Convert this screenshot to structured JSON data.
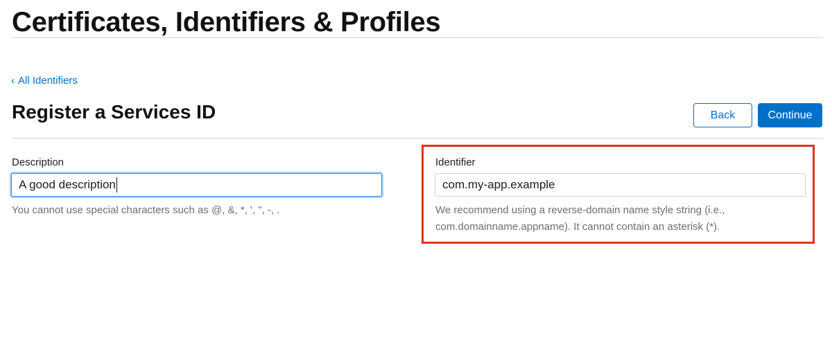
{
  "header": {
    "title": "Certificates, Identifiers & Profiles"
  },
  "nav": {
    "back_link_chevron": "‹",
    "back_link_label": "All Identifiers"
  },
  "section": {
    "title": "Register a Services ID"
  },
  "actions": {
    "back_label": "Back",
    "continue_label": "Continue"
  },
  "description_field": {
    "label": "Description",
    "value": "A good description",
    "help": "You cannot use special characters such as @, &, *, ', \", -, ."
  },
  "identifier_field": {
    "label": "Identifier",
    "value": "com.my-app.example",
    "help_line1": "We recommend using a reverse-domain name style string (i.e.,",
    "help_line2": "com.domainname.appname). It cannot contain an asterisk (*)."
  },
  "colors": {
    "accent": "#0070c9",
    "highlight": "#e0321f",
    "muted_text": "#6e6e73"
  }
}
